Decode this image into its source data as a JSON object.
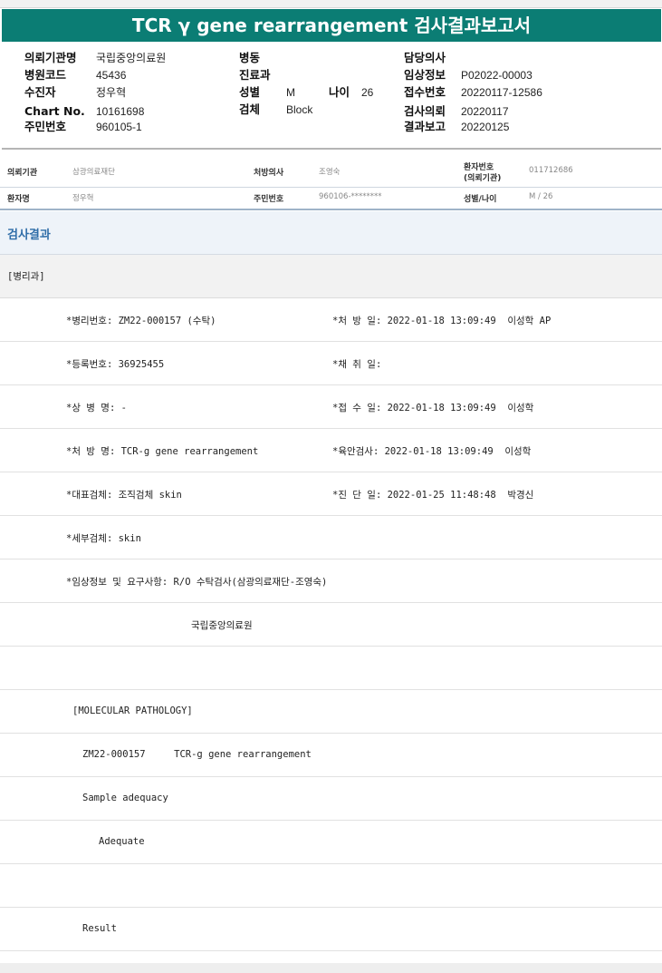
{
  "title": "TCR γ gene rearrangement 검사결과보고서",
  "header": {
    "left": [
      {
        "label": "의뢰기관명",
        "value": "국립중앙의료원"
      },
      {
        "label": "병원코드",
        "value": "45436"
      },
      {
        "label": "수진자",
        "value": "정우혁"
      },
      {
        "label": "Chart No.",
        "value": "10161698"
      },
      {
        "label": "주민번호",
        "value": "960105-1"
      }
    ],
    "middle": [
      {
        "label": "병동",
        "value": ""
      },
      {
        "label": "진료과",
        "value": ""
      },
      {
        "label": "성별",
        "value": "M"
      },
      {
        "label": "검체",
        "value": "Block"
      }
    ],
    "age": {
      "label": "나이",
      "value": "26"
    },
    "right": [
      {
        "label": "담당의사",
        "value": ""
      },
      {
        "label": "임상정보",
        "value": "P02022-00003"
      },
      {
        "label": "접수번호",
        "value": "20220117-12586"
      },
      {
        "label": "검사의뢰",
        "value": "20220117"
      },
      {
        "label": "결과보고",
        "value": "20220125"
      }
    ]
  },
  "info": {
    "r1": {
      "k1": "의뢰기관",
      "v1": "삼광의료재단",
      "k2": "처방의사",
      "v2": "조영숙",
      "k3a": "환자번호",
      "k3b": "(의뢰기관)",
      "v3": "011712686"
    },
    "r2": {
      "k1": "환자명",
      "v1": "정우혁",
      "k2": "주민번호",
      "v2": "960106-********",
      "k3": "성별/나이",
      "v3": "M / 26"
    }
  },
  "section_title": "검사결과",
  "dept": "[병리과]",
  "rows": {
    "r1a": "*병리번호: ZM22-000157 (수탁)",
    "r1b": "*처 방 일: 2022-01-18 13:09:49  이성학 AP",
    "r2a": "*등록번호: 36925455",
    "r2b": "*채 취 일:",
    "r3a": "*상 병 명: -",
    "r3b": "*접 수 일: 2022-01-18 13:09:49  이성학",
    "r4a": "*처 방 명: TCR-g gene rearrangement",
    "r4b": "*육안검사: 2022-01-18 13:09:49  이성학",
    "r5a": "*대표검체: 조직검체 skin",
    "r5b": "*진 단 일: 2022-01-25 11:48:48  박경신",
    "r6a": "*세부검체: skin",
    "r7a": "*임상정보 및 요구사항: R/O 수탁검사(삼광의료재단-조영숙)",
    "r8a": "국립중앙의료원",
    "r10a": "[MOLECULAR PATHOLOGY]",
    "r11a": "ZM22-000157     TCR-g gene rearrangement",
    "r12a": "Sample adequacy",
    "r13a": "Adequate",
    "r15a": "Result"
  }
}
